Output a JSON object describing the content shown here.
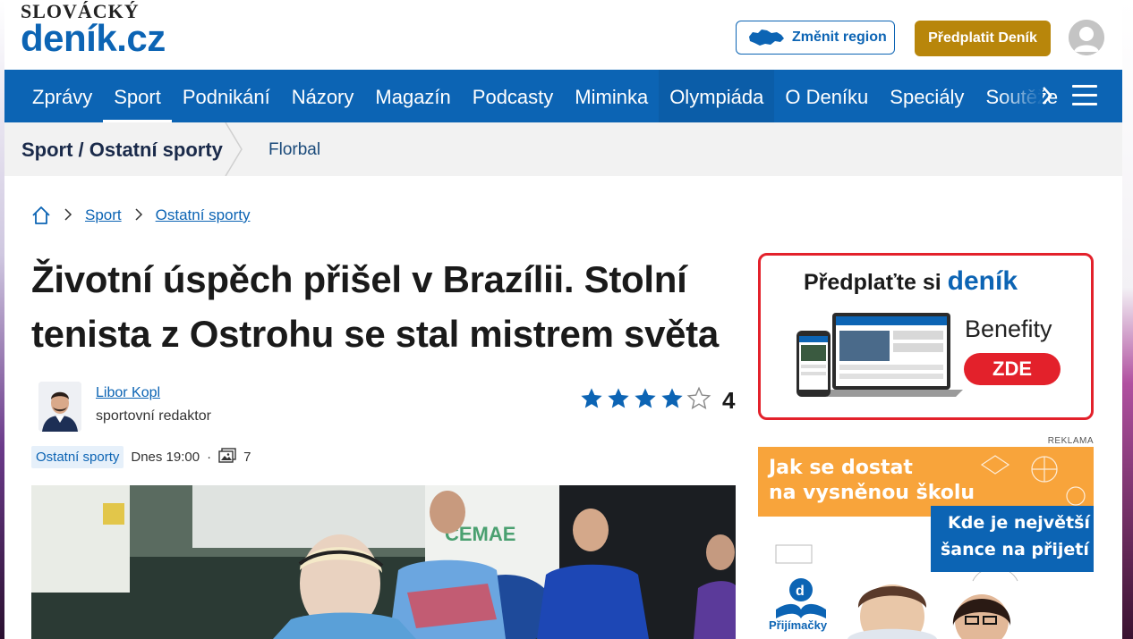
{
  "header": {
    "logo_top": "SLOVÁCKÝ",
    "logo_main": "deník.cz",
    "region_button": "Změnit region",
    "subscribe_button": "Předplatit Deník"
  },
  "nav": {
    "items": [
      {
        "label": "Zprávy"
      },
      {
        "label": "Sport"
      },
      {
        "label": "Podnikání"
      },
      {
        "label": "Názory"
      },
      {
        "label": "Magazín"
      },
      {
        "label": "Podcasty"
      },
      {
        "label": "Miminka"
      },
      {
        "label": "Olympiáda"
      },
      {
        "label": "O Deníku"
      },
      {
        "label": "Speciály"
      },
      {
        "label": "Soutěže"
      }
    ],
    "active": "Sport"
  },
  "section": {
    "title": "Sport / Ostatní sporty",
    "subsection": "Florbal"
  },
  "breadcrumb": {
    "items": [
      "Sport",
      "Ostatní sporty"
    ]
  },
  "article": {
    "headline": "Životní úspěch přišel v Brazílii. Stolní tenista z Ostrohu se stal mistrem světa",
    "author_name": "Libor Kopl",
    "author_role": "sportovní redaktor",
    "rating_value": "4",
    "rating_stars_filled": 4,
    "rating_stars_total": 5,
    "tag": "Ostatní sporty",
    "published": "Dnes 19:00",
    "photo_count": "7"
  },
  "sidebar": {
    "ad1_title": "Předplaťte si",
    "ad1_brand": "deník",
    "ad1_benefits": "Benefity",
    "ad1_cta": "ZDE",
    "reklama": "REKLAMA",
    "ad2_line1": "Jak se dostat",
    "ad2_line2": "na vysněnou školu",
    "ad2_line3": "Kde je největší",
    "ad2_line4": "šance na přijetí",
    "ad2_logo": "Přijímačky"
  },
  "colors": {
    "brand_blue": "#0c64b4",
    "subscribe_gold": "#b8860b",
    "ad_red": "#e3212b",
    "ad_orange": "#f8a43b"
  }
}
